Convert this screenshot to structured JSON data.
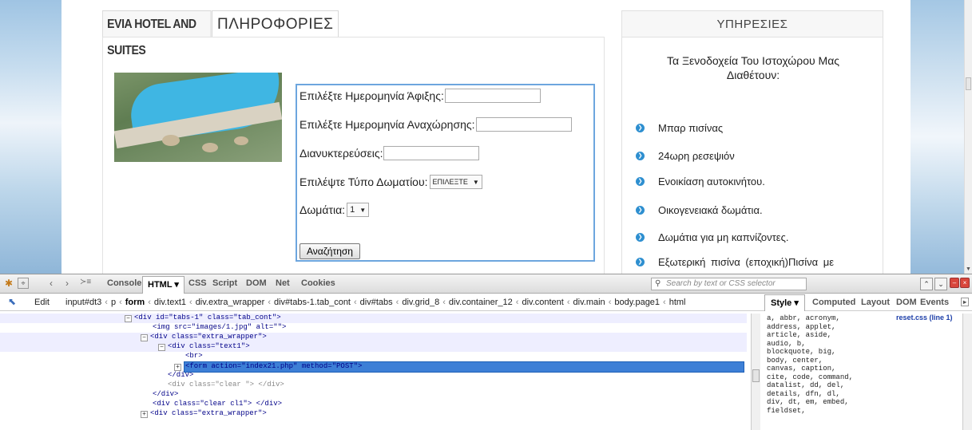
{
  "page": {
    "tab_hotel": "EVIA HOTEL AND SUITES",
    "tab_info": "ΠΛΗΡΟΦΟΡΙΕΣ",
    "form": {
      "arrival_label": "Επιλέξτε Ημερομηνία Άφιξης:",
      "departure_label": "Επιλέξτε Ημερομηνία Αναχώρησης:",
      "nights_label": "Διανυκτερεύσεις:",
      "room_type_label": "Επιλέψτε Τύπο Δωματίου:",
      "room_type_value": "ΕΠΙΛΕΞΤΕ",
      "rooms_label": "Δωμάτια:",
      "rooms_value": "1",
      "search_button": "Αναζήτηση"
    },
    "services": {
      "title": "ΥΠΗΡΕΣΙΕΣ",
      "intro": "Τα Ξενοδοχεία Του Ιστοχώρου Μας Διαθέτουν:",
      "items": [
        "Μπαρ πισίνας",
        "24ωρη ρεσεψιόν",
        "Ενοικίαση αυτοκινήτου.",
        "Οικογενειακά δωμάτια.",
        "Δωμάτια για μη καπνίζοντες.",
        "Εξωτερική πισίνα (εποχική)Πισίνα με"
      ]
    }
  },
  "firebug": {
    "tabs": [
      "Console",
      "HTML ▾",
      "CSS",
      "Script",
      "DOM",
      "Net",
      "Cookies"
    ],
    "search_placeholder": "Search by text or CSS selector",
    "edit_label": "Edit",
    "breadcrumbs": [
      "input#dt3",
      "p",
      "form",
      "div.text1",
      "div.extra_wrapper",
      "div#tabs-1.tab_cont",
      "div#tabs",
      "div.grid_8",
      "div.container_12",
      "div.content",
      "div.main",
      "body.page1",
      "html"
    ],
    "side_tabs": [
      "Style ▾",
      "Computed",
      "Layout",
      "DOM",
      "Events"
    ],
    "tree": [
      "<div id=\"tabs-1\" class=\"tab_cont\">",
      "<img src=\"images/1.jpg\" alt=\"\">",
      "<div class=\"extra_wrapper\">",
      "<div class=\"text1\">",
      "<br>",
      "<form action=\"index21.php\" method=\"POST\">",
      "</div>",
      "<div class=\"clear \"> </div>",
      "</div>",
      "<div class=\"clear cl1\"> </div>",
      "<div class=\"extra_wrapper\">"
    ],
    "style_rule_source": "reset.css (line 1)",
    "style_selectors": [
      "a, abbr, acronym,",
      "address, applet,",
      "article, aside,",
      "audio, b,",
      "blockquote, big,",
      "body, center,",
      "canvas, caption,",
      "cite, code, command,",
      "datalist, dd, del,",
      "details, dfn, dl,",
      "div, dt, em, embed,",
      "fieldset,"
    ]
  }
}
